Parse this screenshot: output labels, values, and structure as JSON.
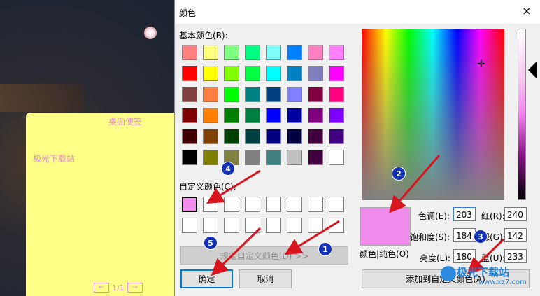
{
  "note": {
    "title": "桌面便签",
    "body": "极光下载站",
    "pager": {
      "prev": "←",
      "text": "1/1",
      "next": "→"
    }
  },
  "dialog": {
    "title": "颜色",
    "close": "×",
    "basic_colors_label": "基本颜色(B):",
    "custom_colors_label": "自定义颜色(C):",
    "basic_colors": [
      "#ff8080",
      "#ffff80",
      "#80ff80",
      "#00ff80",
      "#80ffff",
      "#0080ff",
      "#ff80c0",
      "#ff80ff",
      "#ff0000",
      "#ffff00",
      "#80ff00",
      "#00ff40",
      "#00ffff",
      "#0080c0",
      "#8080c0",
      "#ff00ff",
      "#804040",
      "#ff8040",
      "#00ff00",
      "#008080",
      "#004080",
      "#8080ff",
      "#800040",
      "#ff0080",
      "#800000",
      "#ff8000",
      "#008000",
      "#008040",
      "#0000ff",
      "#0000a0",
      "#800080",
      "#8000ff",
      "#400000",
      "#804000",
      "#004000",
      "#004040",
      "#000080",
      "#000040",
      "#400040",
      "#400080",
      "#000000",
      "#808000",
      "#808040",
      "#808080",
      "#408080",
      "#c0c0c0",
      "#400040",
      "#ffffff"
    ],
    "custom_colors": [
      "#f08cec",
      "#ffffff",
      "#ffffff",
      "#ffffff",
      "#ffffff",
      "#ffffff",
      "#ffffff",
      "#ffffff",
      "#ffffff",
      "#ffffff",
      "#ffffff",
      "#ffffff",
      "#ffffff",
      "#ffffff",
      "#ffffff",
      "#ffffff"
    ],
    "define_custom_button": "规定自定义颜色(D) >>",
    "ok_button": "确定",
    "cancel_button": "取消",
    "preview_label": "颜色|纯色(O)",
    "add_custom_button": "添加到自定义颜色(A)",
    "fields": {
      "hue": {
        "label": "色调(E):",
        "value": "203"
      },
      "sat": {
        "label": "饱和度(S):",
        "value": "184"
      },
      "lum": {
        "label": "亮度(L):",
        "value": "180"
      },
      "red": {
        "label": "红(R):",
        "value": "240"
      },
      "green": {
        "label": "绿(G):",
        "value": "142"
      },
      "blue": {
        "label": "蓝(U):",
        "value": "233"
      }
    },
    "preview_color": "#f08cec"
  },
  "annotations": [
    "1",
    "2",
    "3",
    "4",
    "5"
  ],
  "watermark": {
    "main": "极光下载站",
    "sub": "www.xz7.com"
  }
}
